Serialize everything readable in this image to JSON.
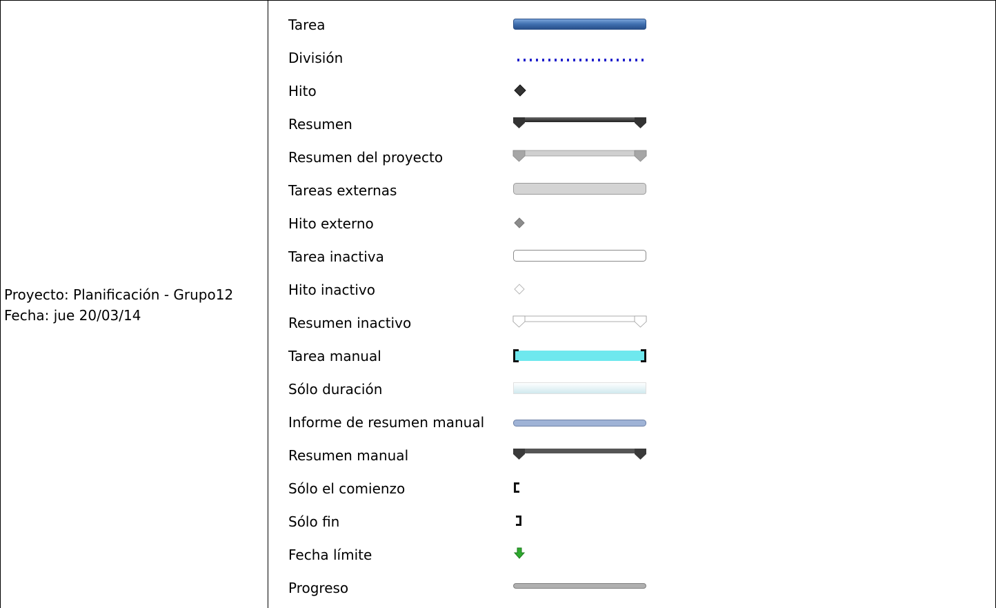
{
  "project": {
    "name_line": "Proyecto: Planificación - Grupo12",
    "date_line": "Fecha: jue 20/03/14"
  },
  "legend_items": [
    {
      "label": "Tarea",
      "symbol": "task-bar-icon"
    },
    {
      "label": "División",
      "symbol": "split-dotted-line-icon"
    },
    {
      "label": "Hito",
      "symbol": "milestone-diamond-icon"
    },
    {
      "label": "Resumen",
      "symbol": "summary-bar-icon"
    },
    {
      "label": "Resumen del proyecto",
      "symbol": "project-summary-bar-icon"
    },
    {
      "label": "Tareas externas",
      "symbol": "external-task-bar-icon"
    },
    {
      "label": "Hito externo",
      "symbol": "external-milestone-icon"
    },
    {
      "label": "Tarea inactiva",
      "symbol": "inactive-task-bar-icon"
    },
    {
      "label": "Hito inactivo",
      "symbol": "inactive-milestone-icon"
    },
    {
      "label": "Resumen inactivo",
      "symbol": "inactive-summary-bar-icon"
    },
    {
      "label": "Tarea manual",
      "symbol": "manual-task-bar-icon"
    },
    {
      "label": "Sólo duración",
      "symbol": "duration-only-bar-icon"
    },
    {
      "label": "Informe de resumen manual",
      "symbol": "manual-summary-rollup-bar-icon"
    },
    {
      "label": "Resumen manual",
      "symbol": "manual-summary-bar-icon"
    },
    {
      "label": "Sólo el comienzo",
      "symbol": "start-only-bracket-icon"
    },
    {
      "label": "Sólo fin",
      "symbol": "finish-only-bracket-icon"
    },
    {
      "label": "Fecha límite",
      "symbol": "deadline-arrow-icon"
    },
    {
      "label": "Progreso",
      "symbol": "progress-bar-icon"
    }
  ],
  "colors": {
    "task": "#3f6faf",
    "split": "#2222cc",
    "milestone": "#333333",
    "summary": "#333333",
    "project_summary": "#b4b4b4",
    "external": "#d4d4d4",
    "external_milestone": "#888888",
    "inactive_border": "#888888",
    "manual_task": "#6ee8ee",
    "manual_rollup": "#9fb3d6",
    "manual_summary": "#555555",
    "deadline": "#2eaa2e",
    "progress": "#b0b0b0"
  }
}
